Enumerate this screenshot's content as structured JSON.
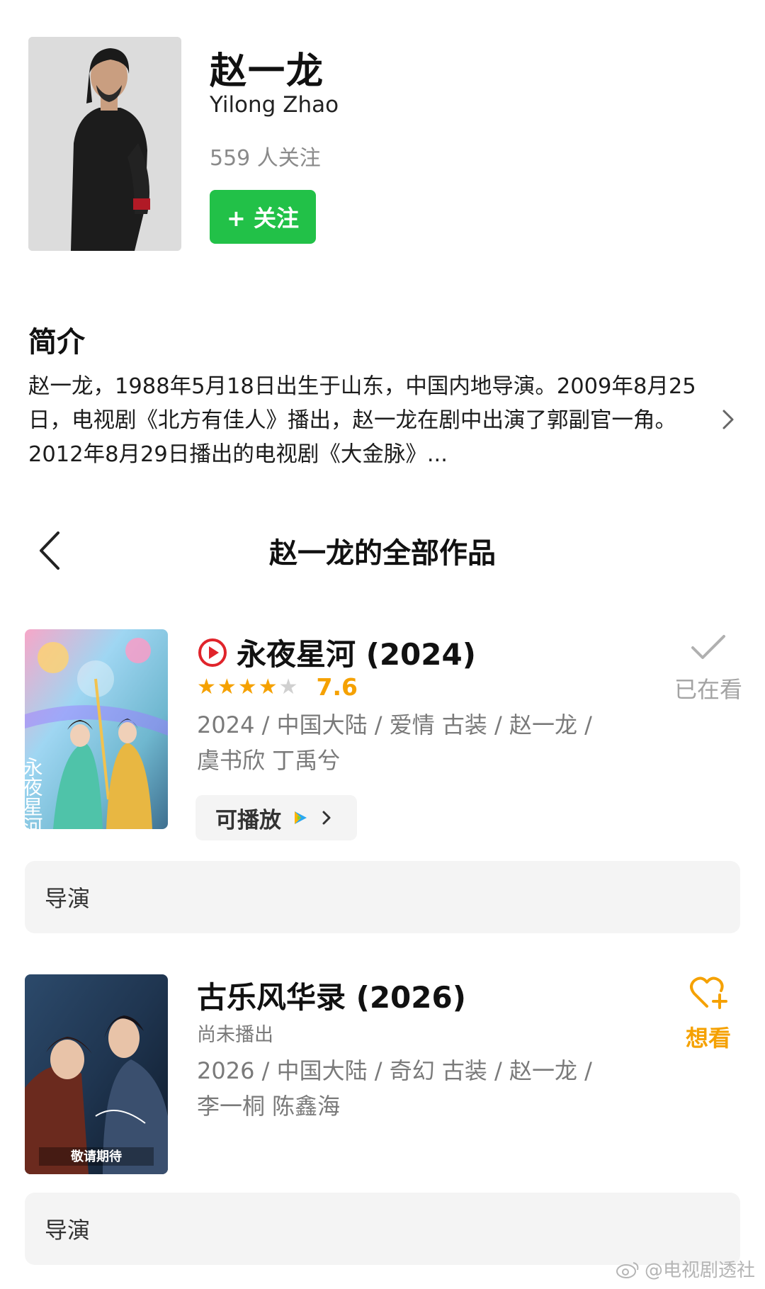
{
  "profile": {
    "name_cn": "赵一龙",
    "name_en": "Yilong Zhao",
    "followers": "559 人关注",
    "follow_button": "+ 关注"
  },
  "intro": {
    "title": "简介",
    "text": "赵一龙，1988年5月18日出生于山东，中国内地导演。2009年8月25日，电视剧《北方有佳人》播出，赵一龙在剧中出演了郭副官一角。2012年8月29日播出的电视剧《大金脉》..."
  },
  "works": {
    "title": "赵一龙的全部作品",
    "items": [
      {
        "title": "永夜星河 (2024)",
        "rating_stars": 4,
        "rating": "7.6",
        "meta_line1": "2024 / 中国大陆 / 爱情 古装 / 赵一龙 /",
        "meta_line2": "虞书欣 丁禹兮",
        "playable_label": "可播放",
        "status_label": "已在看",
        "role": "导演"
      },
      {
        "title": "古乐风华录 (2026)",
        "sub_status": "尚未播出",
        "meta_line1": "2026 / 中国大陆 / 奇幻 古装 / 赵一龙 /",
        "meta_line2": "李一桐 陈鑫海",
        "status_label": "想看",
        "poster_text": "敬请期待",
        "role": "导演"
      }
    ]
  },
  "colors": {
    "follow_green": "#22c148",
    "accent_orange": "#f5a100",
    "play_red": "#e0242b"
  },
  "watermark": "@电视剧透社"
}
